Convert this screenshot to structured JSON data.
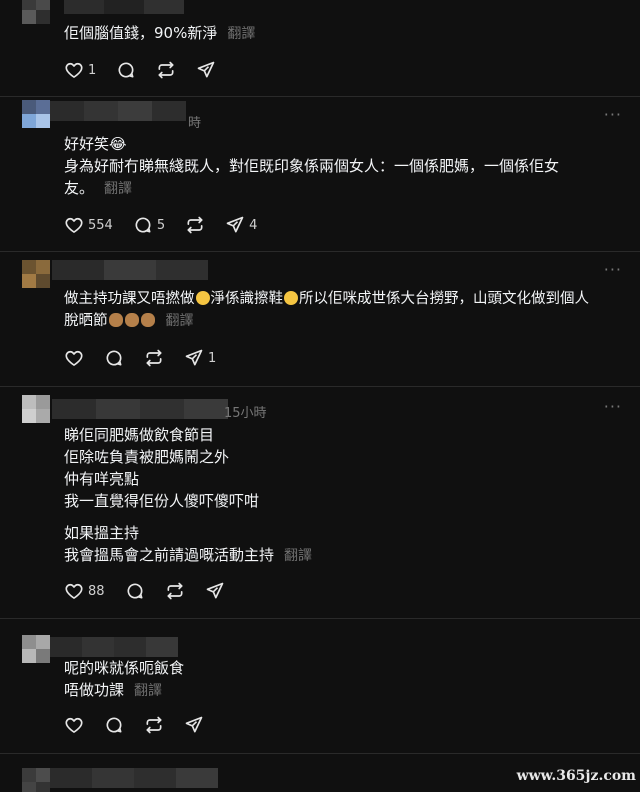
{
  "posts": [
    {
      "lines": [
        "佢個腦值錢，90%新淨"
      ],
      "translate": "翻譯",
      "likes": "1",
      "replies": "",
      "reposts": "",
      "shares": ""
    },
    {
      "time": "時",
      "lines": [
        "好好笑😂",
        "身為好耐冇睇無綫既人，對佢既印象係兩個女人：一個係肥媽，一個係佢女",
        "友。"
      ],
      "translate": "翻譯",
      "likes": "554",
      "replies": "5",
      "reposts": "",
      "shares": "4"
    },
    {
      "lines_rich": {
        "l1a": "做主持功課又唔撚做",
        "l1b": "淨係識擦鞋",
        "l1c": "所以佢咪成世係大台撈野，山頭文化做到個人",
        "l2a": "脫晒節"
      },
      "translate": "翻譯",
      "likes": "",
      "replies": "",
      "reposts": "",
      "shares": "1"
    },
    {
      "time": "15小時",
      "lines": [
        "睇佢同肥媽做飲食節目",
        "佢除咗負責被肥媽鬧之外",
        "仲有咩亮點",
        "我一直覺得佢份人傻吓傻吓咁"
      ],
      "lines2": [
        "如果搵主持",
        "我會搵馬會之前請過嘅活動主持"
      ],
      "translate": "翻譯",
      "likes": "88",
      "replies": "",
      "reposts": "",
      "shares": ""
    },
    {
      "lines": [
        "呢的咪就係呃飯食",
        "唔做功課"
      ],
      "translate": "翻譯",
      "likes": "",
      "replies": "",
      "reposts": "",
      "shares": ""
    }
  ],
  "more_label": "···",
  "watermark": "www.365jz.com",
  "icons": {
    "like": "heart-icon",
    "reply": "comment-icon",
    "repost": "repost-icon",
    "share": "send-icon",
    "more": "more-options-icon"
  },
  "colors": {
    "background": "#101010",
    "text": "#f3f5f7",
    "muted": "#6f6f6f",
    "divider": "#2a2a2a"
  }
}
